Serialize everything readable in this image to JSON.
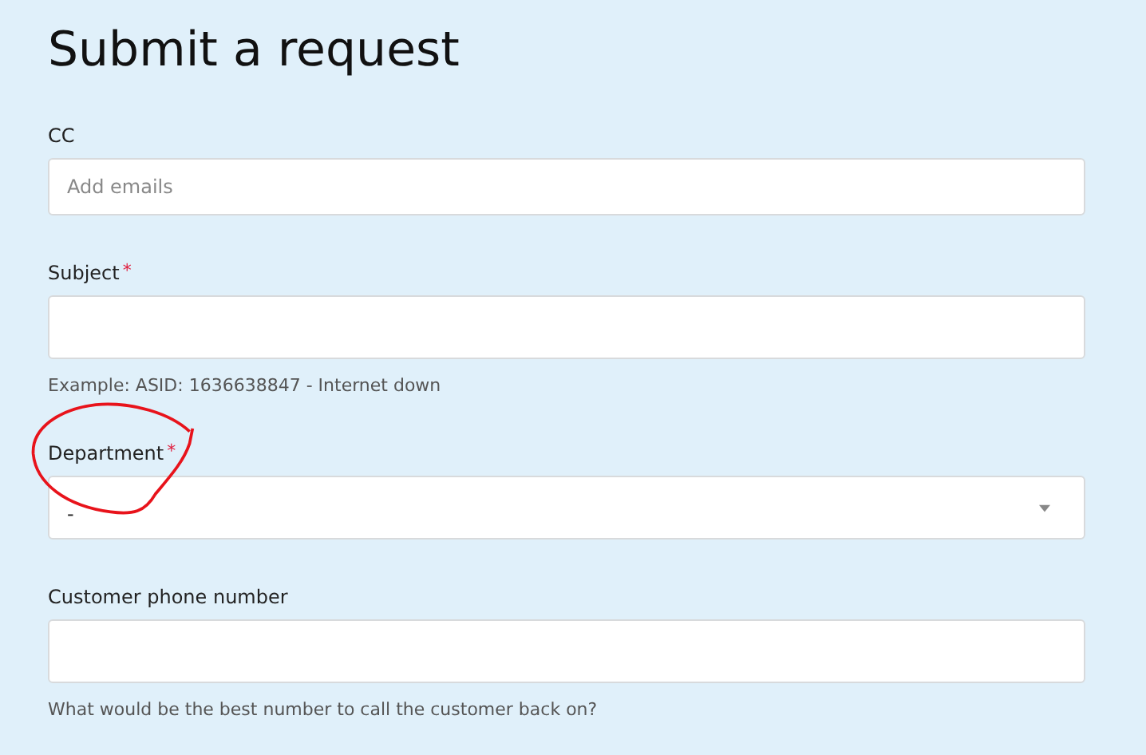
{
  "title": "Submit a request",
  "fields": [
    {
      "kind": "text",
      "label": "CC",
      "placeholder": "Add emails"
    },
    {
      "kind": "text",
      "label": "Subject",
      "required_mark": "*",
      "hint": "Example: ASID: 1636638847 - Internet down"
    },
    {
      "kind": "select",
      "label": "Department",
      "required_mark": "*",
      "value": "-",
      "annotated": true
    },
    {
      "kind": "text",
      "label": "Customer phone number",
      "hint": "What would be the best number to call the customer back on?"
    }
  ]
}
